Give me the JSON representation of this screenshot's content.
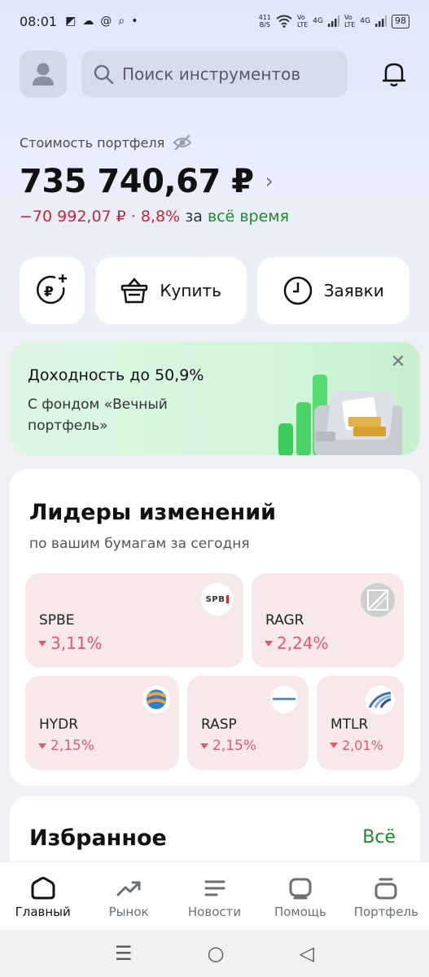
{
  "status_bar": {
    "time": "08:01",
    "net_speed_value": "411",
    "net_speed_unit": "B/S",
    "sim1": "Vo\nLTE",
    "sim1_net": "4G",
    "sim2": "Vo\nLTE",
    "sim2_net": "4G",
    "battery": "98"
  },
  "header": {
    "search_placeholder": "Поиск инструментов"
  },
  "portfolio": {
    "label": "Стоимость портфеля",
    "value": "735 740,67 ₽",
    "change_amount": "−70 992,07 ₽",
    "change_sep": " · ",
    "change_percent": "8,8%",
    "period_prefix": " за ",
    "period_label": "всё время"
  },
  "actions": {
    "buy_label": "Купить",
    "orders_label": "Заявки"
  },
  "promo": {
    "title": "Доходность до 50,9%",
    "subtitle": "С фондом «Вечный портфель»"
  },
  "leaders": {
    "title": "Лидеры изменений",
    "subtitle": "по вашим бумагам за сегодня",
    "items": [
      {
        "ticker": "SPBE",
        "change": "3,11%",
        "logo_text": "SPB"
      },
      {
        "ticker": "RAGR",
        "change": "2,24%"
      },
      {
        "ticker": "HYDR",
        "change": "2,15%"
      },
      {
        "ticker": "RASP",
        "change": "2,15%"
      },
      {
        "ticker": "MTLR",
        "change": "2,01%"
      }
    ]
  },
  "favorites": {
    "title": "Избранное",
    "all_label": "Всё"
  },
  "bottom_nav": {
    "items": [
      {
        "label": "Главный",
        "icon": "home-icon"
      },
      {
        "label": "Рынок",
        "icon": "trend-icon"
      },
      {
        "label": "Новости",
        "icon": "news-icon"
      },
      {
        "label": "Помощь",
        "icon": "chat-icon"
      },
      {
        "label": "Портфель",
        "icon": "briefcase-icon"
      }
    ]
  },
  "colors": {
    "negative": "#d0223a",
    "positive": "#1f8a2d",
    "tile_bg": "#f7e8ea"
  }
}
